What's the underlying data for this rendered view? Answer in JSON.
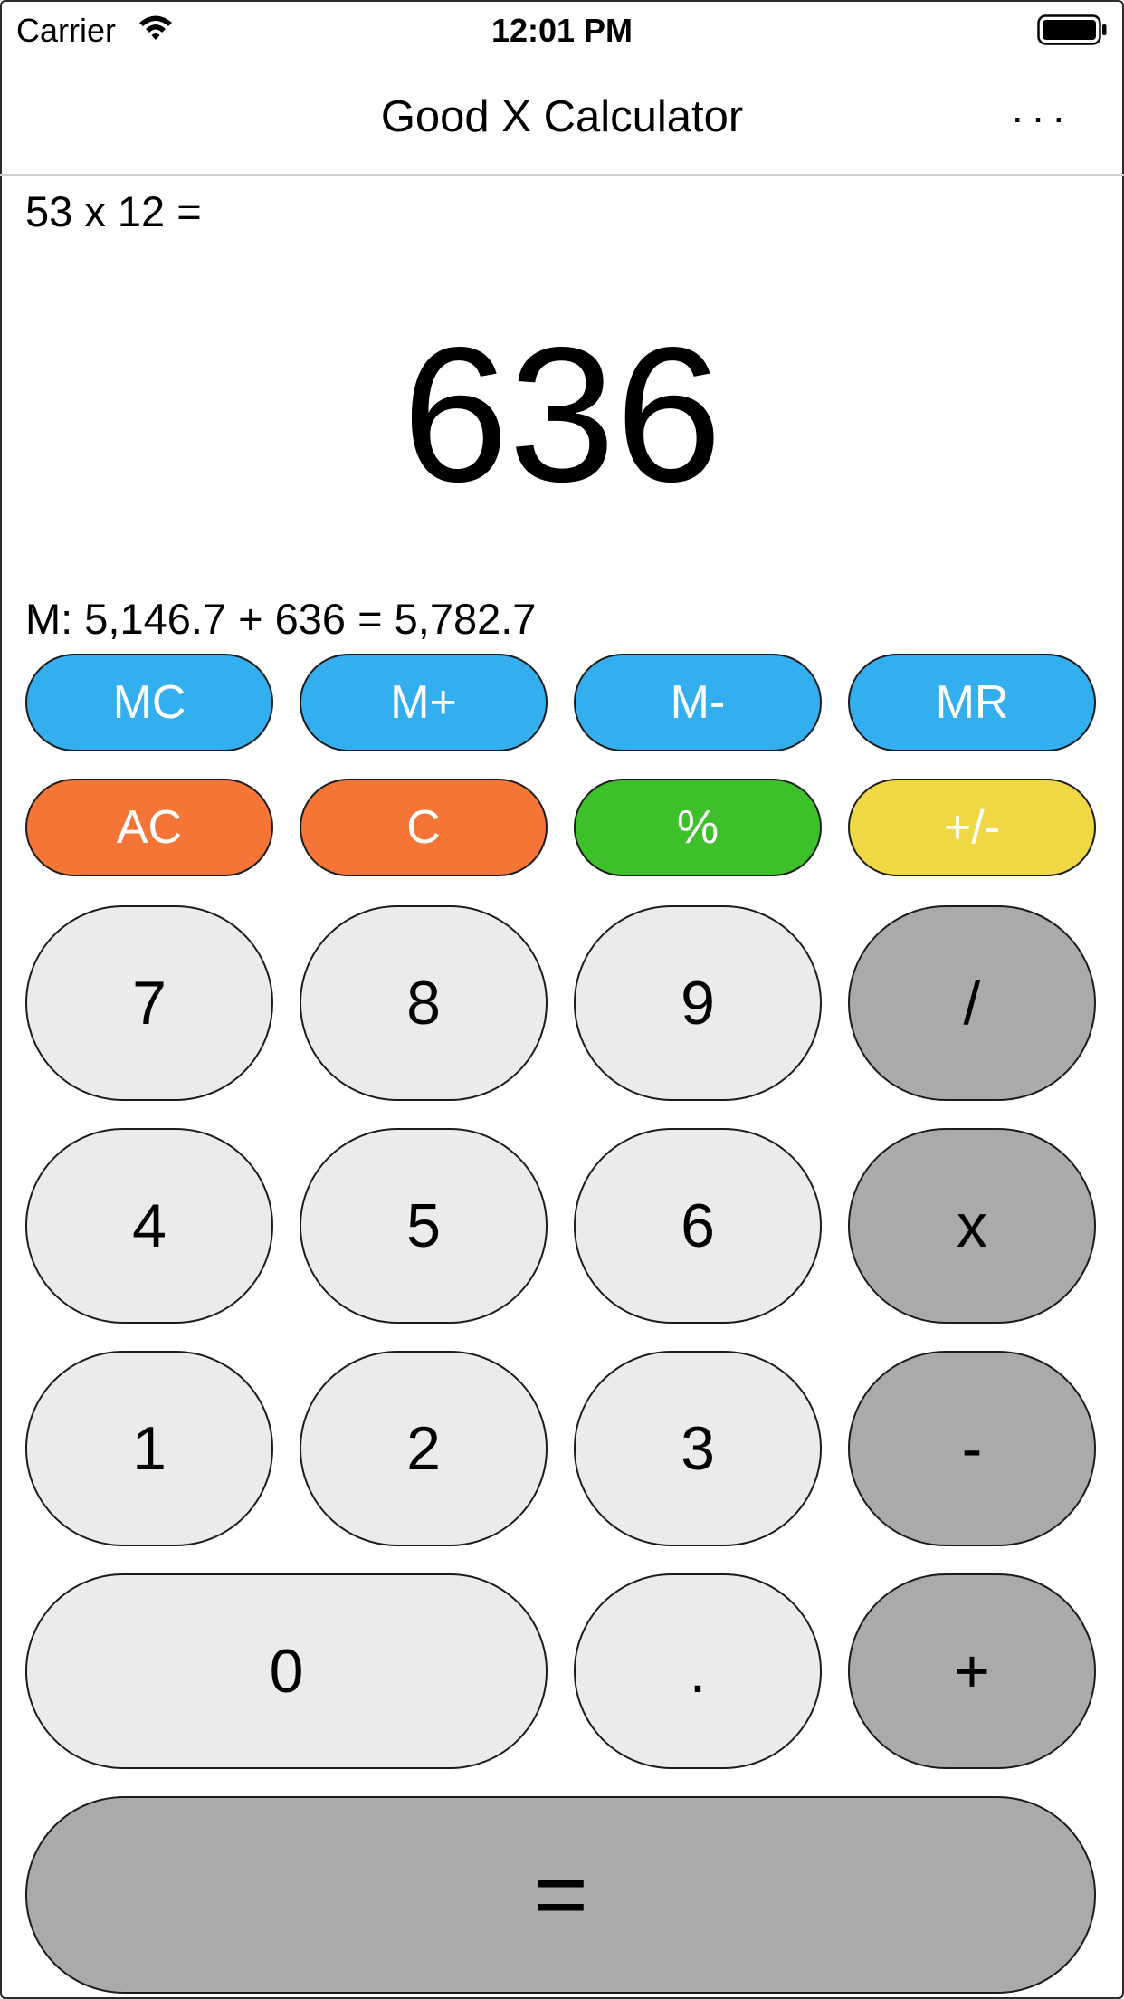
{
  "status_bar": {
    "carrier": "Carrier",
    "time": "12:01 PM",
    "wifi_icon": "wifi-icon",
    "battery_icon": "battery-icon"
  },
  "nav": {
    "title": "Good X Calculator",
    "more_label": "..."
  },
  "display": {
    "expression": "53 x 12 =",
    "result": "636",
    "memory": "M: 5,146.7 + 636 = 5,782.7"
  },
  "memory_keys": {
    "mc": "MC",
    "m_plus": "M+",
    "m_minus": "M-",
    "mr": "MR"
  },
  "function_keys": {
    "ac": "AC",
    "c": "C",
    "percent": "%",
    "sign": "+/-"
  },
  "keypad": {
    "seven": "7",
    "eight": "8",
    "nine": "9",
    "divide": "/",
    "four": "4",
    "five": "5",
    "six": "6",
    "multiply": "x",
    "one": "1",
    "two": "2",
    "three": "3",
    "minus": "-",
    "zero": "0",
    "decimal": ".",
    "plus": "+",
    "equals": "="
  },
  "colors": {
    "memory_button": "#33aeee",
    "clear_button": "#f47536",
    "percent_button": "#3ec02b",
    "sign_button": "#efd843",
    "number_key": "#ebebeb",
    "operator_key": "#aaaaaa"
  }
}
